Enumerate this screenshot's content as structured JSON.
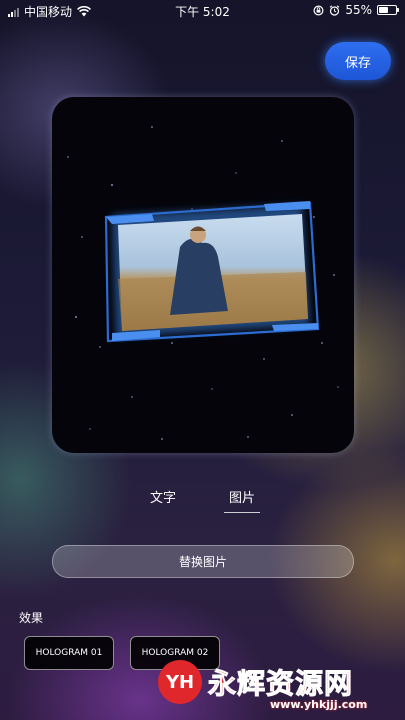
{
  "status_bar": {
    "carrier": "中国移动",
    "time": "下午 5:02",
    "battery_percent": "55%",
    "battery_level": 0.55
  },
  "header": {
    "save_label": "保存"
  },
  "tabs": [
    {
      "label": "文字",
      "selected": false
    },
    {
      "label": "图片",
      "selected": true
    }
  ],
  "replace_button_label": "替换图片",
  "effects": {
    "label": "效果",
    "items": [
      {
        "label": "HOLOGRAM 01"
      },
      {
        "label": "HOLOGRAM 02"
      }
    ]
  },
  "watermark": {
    "logo": "YH",
    "title": "永辉资源网",
    "url": "www.yhkjjj.com"
  },
  "colors": {
    "accent": "#2563e8",
    "watermark": "#e0282c"
  }
}
